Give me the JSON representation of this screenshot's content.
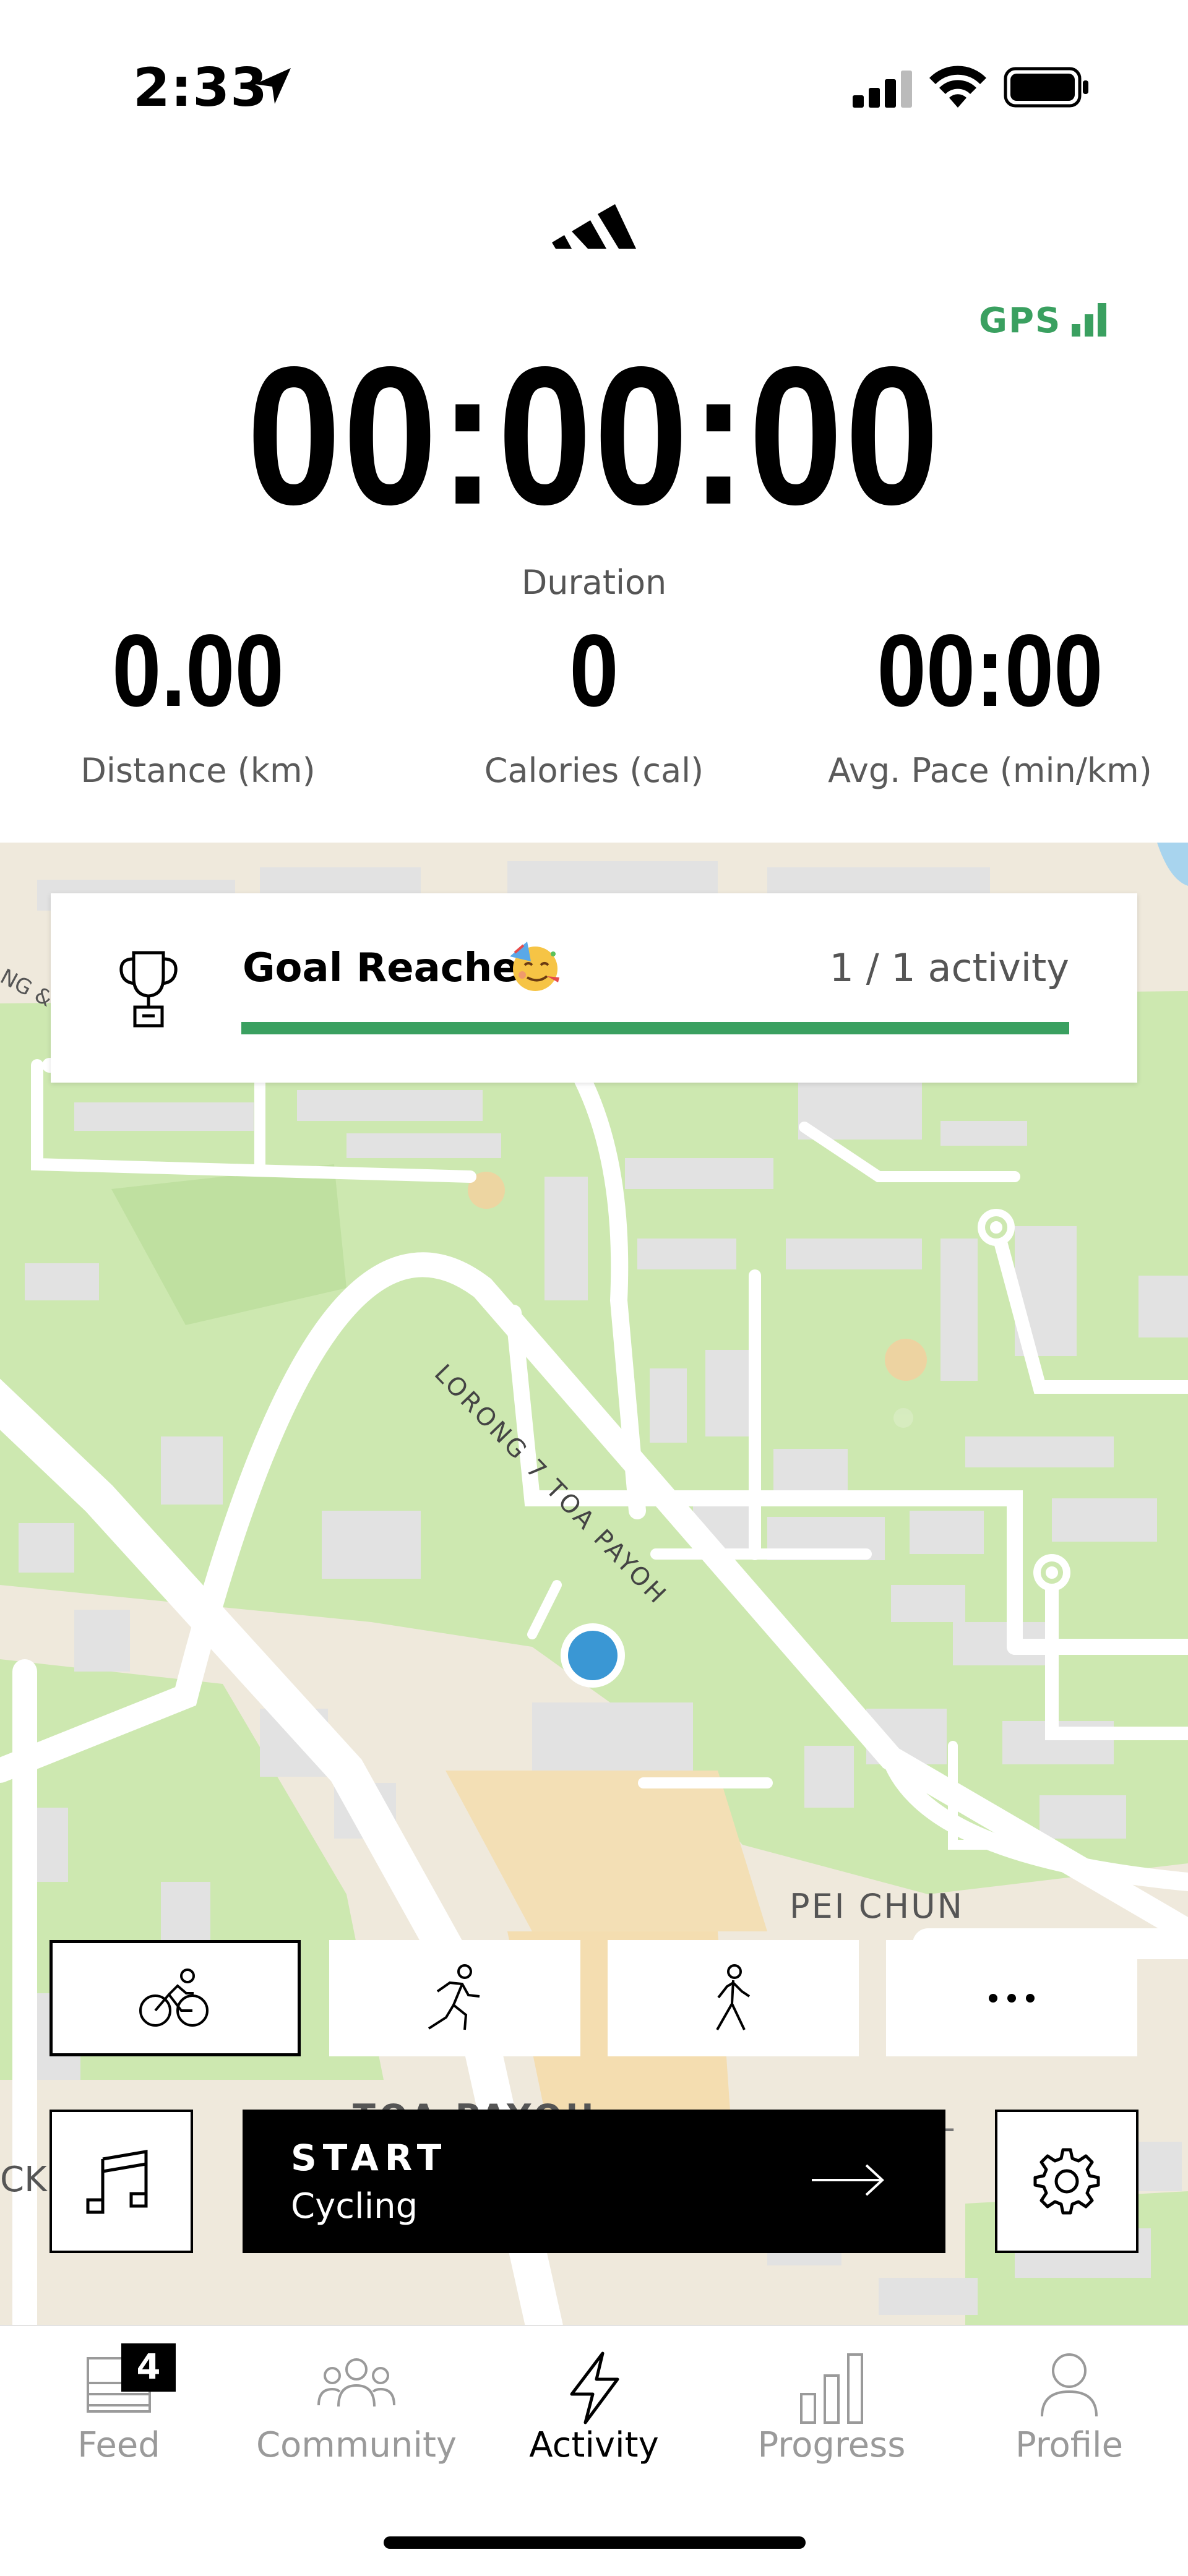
{
  "status_bar": {
    "time": "2:33"
  },
  "gps": {
    "label": "GPS"
  },
  "tracker": {
    "duration": "00:00:00",
    "duration_label": "Duration",
    "stats": [
      {
        "value": "0.00",
        "label": "Distance (km)"
      },
      {
        "value": "0",
        "label": "Calories (cal)"
      },
      {
        "value": "00:00",
        "label": "Avg. Pace (min/km)"
      }
    ]
  },
  "map": {
    "street_label": "LORONG 7 TOA PAYOH",
    "area_label": "PEI CHUN",
    "edge_label_left": "CK",
    "edge_label_topleft": "NG &",
    "faint_label": "T",
    "faint_bottom_label": "TOA PAYOH"
  },
  "goal": {
    "title": "Goal Reached",
    "emoji": "partying-face",
    "count": "1 / 1 activity",
    "progress": 1.0,
    "progress_color": "#3aa060"
  },
  "sports": [
    {
      "name": "cycling",
      "selected": true
    },
    {
      "name": "running",
      "selected": false
    },
    {
      "name": "walking",
      "selected": false
    },
    {
      "name": "more",
      "label": "..."
    }
  ],
  "start": {
    "label": "START",
    "activity": "Cycling"
  },
  "tabs": [
    {
      "label": "Feed",
      "badge": "4",
      "active": false
    },
    {
      "label": "Community",
      "active": false
    },
    {
      "label": "Activity",
      "active": true
    },
    {
      "label": "Progress",
      "active": false
    },
    {
      "label": "Profile",
      "active": false
    }
  ],
  "colors": {
    "accent_green": "#3aa060",
    "map_park": "#cde8b0",
    "map_road": "#ffffff",
    "location_dot": "#3a97d4"
  }
}
